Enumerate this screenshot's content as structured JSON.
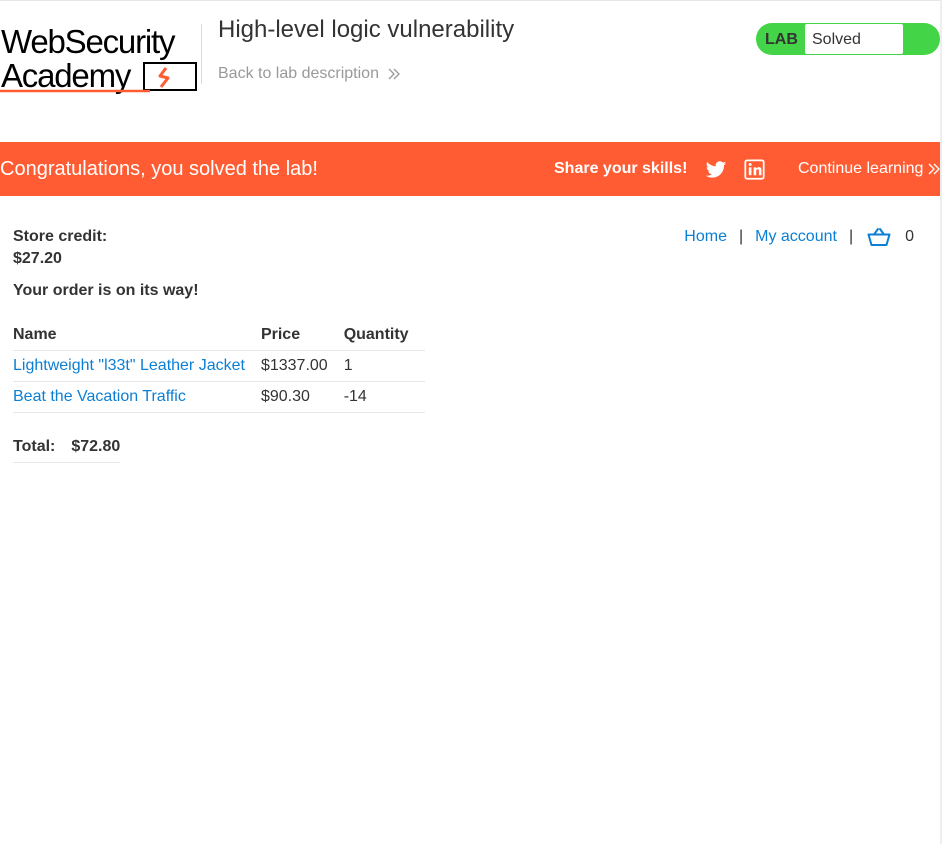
{
  "header": {
    "logo_line1": "WebSecurity",
    "logo_line2": "Academy",
    "lab_title": "High-level logic vulnerability",
    "back_link": "Back to lab description",
    "lab_badge_label": "LAB",
    "lab_status": "Solved"
  },
  "banner": {
    "congrats": "Congratulations, you solved the lab!",
    "share": "Share your skills!",
    "continue": "Continue learning"
  },
  "account": {
    "credit_label": "Store credit:",
    "credit_value": "$27.20",
    "order_message": "Your order is on its way!"
  },
  "nav": {
    "home": "Home",
    "separator": "|",
    "my_account": "My account",
    "cart_count": "0"
  },
  "order_table": {
    "headers": [
      "Name",
      "Price",
      "Quantity"
    ],
    "rows": [
      {
        "name": "Lightweight \"l33t\" Leather Jacket",
        "price": "$1337.00",
        "quantity": "1"
      },
      {
        "name": "Beat the Vacation Traffic",
        "price": "$90.30",
        "quantity": "-14"
      }
    ]
  },
  "total": {
    "label": "Total:",
    "value": "$72.80"
  },
  "colors": {
    "accent_orange": "#ff5c33",
    "lab_green": "#44d448",
    "link_blue": "#0b7fd4"
  }
}
